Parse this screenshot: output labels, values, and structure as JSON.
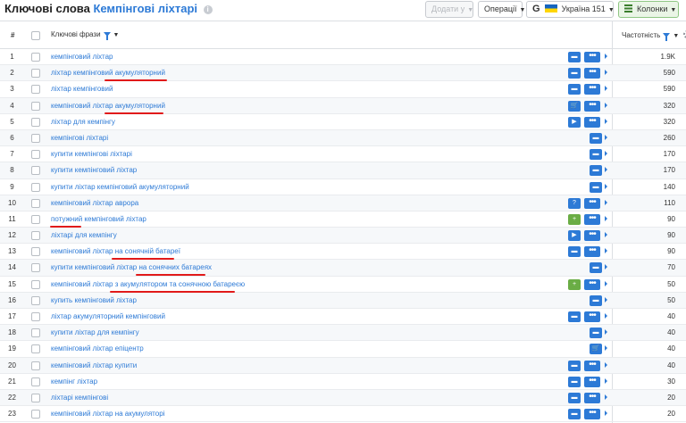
{
  "header": {
    "title_prefix": "Ключові слова",
    "title_topic": "Кемпінгові ліхтарі",
    "info_icon": "info-icon",
    "add_button": "Додати у",
    "operations_button": "Операції",
    "engine_letter": "G",
    "region": "Україна 151",
    "columns_button": "Колонки"
  },
  "table": {
    "col_num": "#",
    "col_keyword": "Ключові фрази",
    "col_frequency": "Частотність",
    "rows": [
      {
        "num": "1",
        "keyword": "кемпінговий ліхтар",
        "freq": "1.9K",
        "icon": "chat",
        "more": true
      },
      {
        "num": "2",
        "keyword": "ліхтар кемпінговий акумуляторний",
        "freq": "590",
        "icon": "chat",
        "more": true
      },
      {
        "num": "3",
        "keyword": "ліхтар кемпінговий",
        "freq": "590",
        "icon": "chat",
        "more": true
      },
      {
        "num": "4",
        "keyword": "кемпінговий ліхтар акумуляторний",
        "freq": "320",
        "icon": "cart",
        "more": true
      },
      {
        "num": "5",
        "keyword": "ліхтар для кемпінгу",
        "freq": "320",
        "icon": "video",
        "more": true
      },
      {
        "num": "6",
        "keyword": "кемпінгові ліхтарі",
        "freq": "260",
        "icon": "chat",
        "more": false
      },
      {
        "num": "7",
        "keyword": "купити кемпінгові ліхтарі",
        "freq": "170",
        "icon": "chat",
        "more": false
      },
      {
        "num": "8",
        "keyword": "купити кемпінговий ліхтар",
        "freq": "170",
        "icon": "chat",
        "more": false
      },
      {
        "num": "9",
        "keyword": "купити ліхтар кемпінговий акумуляторний",
        "freq": "140",
        "icon": "chat",
        "more": false
      },
      {
        "num": "10",
        "keyword": "кемпінговий ліхтар аврора",
        "freq": "110",
        "icon": "question",
        "more": true
      },
      {
        "num": "11",
        "keyword": "потужний кемпінговий ліхтар",
        "freq": "90",
        "icon": "sitelinks",
        "more": true
      },
      {
        "num": "12",
        "keyword": "ліхтарі для кемпінгу",
        "freq": "90",
        "icon": "video",
        "more": true
      },
      {
        "num": "13",
        "keyword": "кемпінговий ліхтар на сонячній батареї",
        "freq": "90",
        "icon": "chat",
        "more": true
      },
      {
        "num": "14",
        "keyword": "купити кемпінговий ліхтар на сонячних батареях",
        "freq": "70",
        "icon": "chat",
        "more": false
      },
      {
        "num": "15",
        "keyword": "кемпінговий ліхтар з акумулятором та сонячною батареєю",
        "freq": "50",
        "icon": "sitelinks",
        "more": true
      },
      {
        "num": "16",
        "keyword": "купить кемпінговий ліхтар",
        "freq": "50",
        "icon": "chat",
        "more": false
      },
      {
        "num": "17",
        "keyword": "ліхтар акумуляторний кемпінговий",
        "freq": "40",
        "icon": "chat",
        "more": true
      },
      {
        "num": "18",
        "keyword": "купити ліхтар для кемпінгу",
        "freq": "40",
        "icon": "chat",
        "more": false
      },
      {
        "num": "19",
        "keyword": "кемпінговий ліхтар епіцентр",
        "freq": "40",
        "icon": "cart",
        "more": false
      },
      {
        "num": "20",
        "keyword": "кемпінговий ліхтар купити",
        "freq": "40",
        "icon": "chat",
        "more": true
      },
      {
        "num": "21",
        "keyword": "кемпінг ліхтар",
        "freq": "30",
        "icon": "chat",
        "more": true
      },
      {
        "num": "22",
        "keyword": "ліхтарі кемпінгові",
        "freq": "20",
        "icon": "chat",
        "more": true
      },
      {
        "num": "23",
        "keyword": "кемпінговий ліхтар на акумуляторі",
        "freq": "20",
        "icon": "chat",
        "more": true
      }
    ]
  },
  "highlights": {
    "color": "#e11a1a",
    "rows": [
      "2",
      "4",
      "11",
      "13",
      "14",
      "15"
    ]
  },
  "colors": {
    "link": "#2d7ad6",
    "feature_icon": "#2d7ad6",
    "sitelinks_icon": "#6aad45",
    "columns_button_bg": "#eaf5e6"
  }
}
